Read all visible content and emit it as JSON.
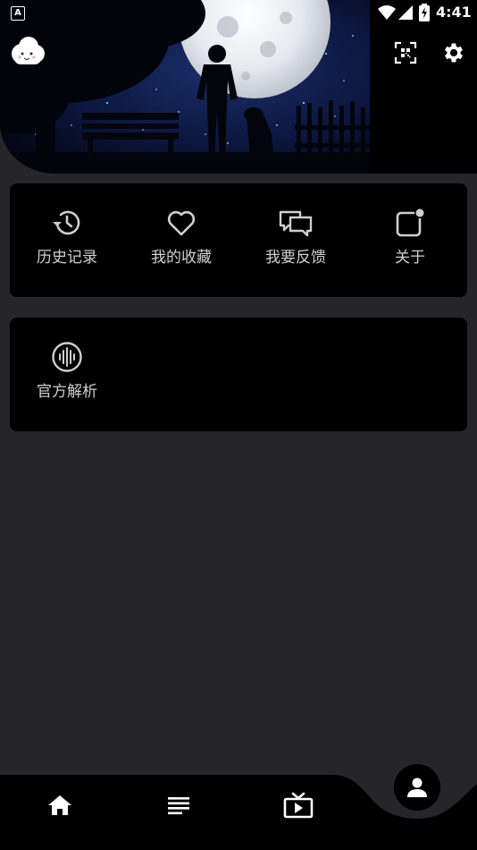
{
  "status_bar": {
    "app_icon_letter": "A",
    "time": "4:41"
  },
  "header": {
    "avatar_icon": "cloud-face-icon",
    "scan_icon": "qr-scan-icon",
    "settings_icon": "gear-icon"
  },
  "menu": {
    "items": [
      {
        "label": "历史记录",
        "icon": "history-icon"
      },
      {
        "label": "我的收藏",
        "icon": "heart-icon"
      },
      {
        "label": "我要反馈",
        "icon": "chat-bubbles-icon"
      },
      {
        "label": "关于",
        "icon": "notification-square-icon"
      }
    ],
    "extra": [
      {
        "label": "官方解析",
        "icon": "audio-wave-icon"
      }
    ]
  },
  "bottom_nav": {
    "items": [
      {
        "icon": "home-icon"
      },
      {
        "icon": "list-icon"
      },
      {
        "icon": "tv-play-icon"
      },
      {
        "icon": "person-icon"
      }
    ]
  },
  "colors": {
    "background": "#25252a",
    "card": "#000000",
    "label": "#d0d0d0",
    "icon": "#cfcfcf"
  }
}
